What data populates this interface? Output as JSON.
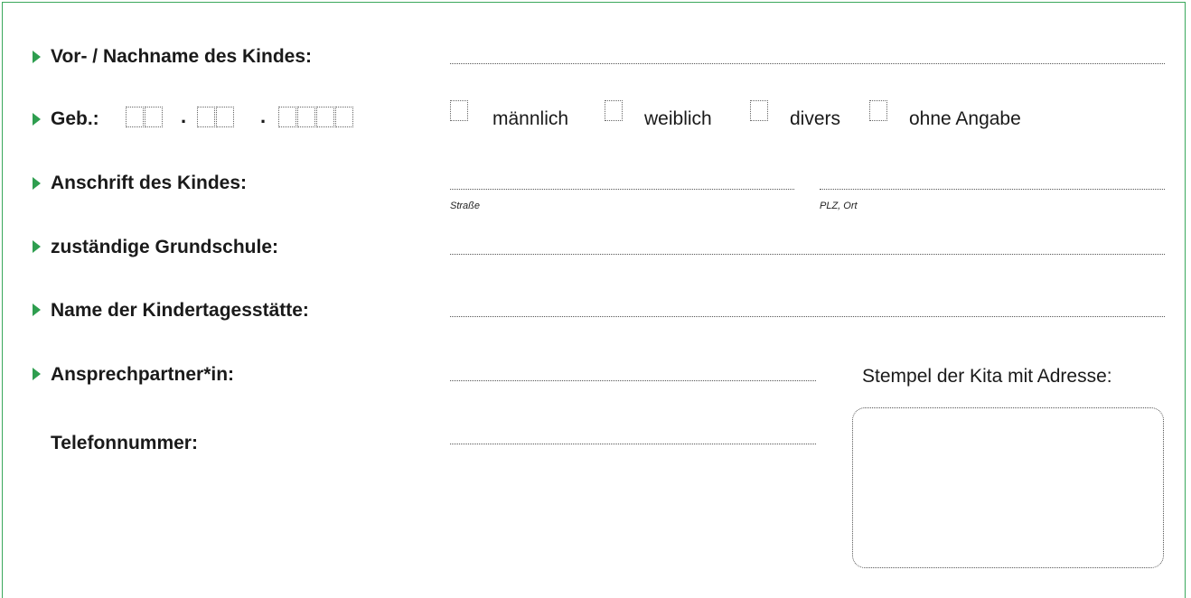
{
  "form": {
    "rows": {
      "child_name": "Vor- / Nachname des Kindes:",
      "birth": "Geb.:",
      "address": "Anschrift des Kindes:",
      "school": "zuständige Grundschule:",
      "daycare": "Name der Kindertagesstätte:",
      "contact": "Ansprechpartner*in:",
      "phone": "Telefonnummer:"
    },
    "birth_separator": ".",
    "gender_options": [
      "männlich",
      "weiblich",
      "divers",
      "ohne Angabe"
    ],
    "address_captions": {
      "street": "Straße",
      "city": "PLZ, Ort"
    },
    "stamp_label": "Stempel der Kita mit Adresse:"
  },
  "colors": {
    "accent": "#2e9e4f",
    "frame": "#3aa85c"
  }
}
